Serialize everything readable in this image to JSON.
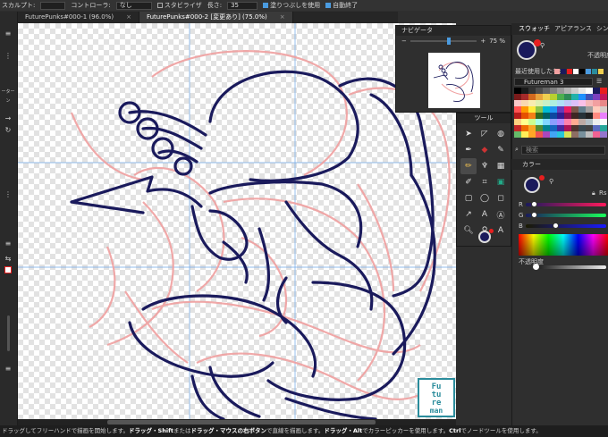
{
  "context_toolbar": {
    "sculpt_label": "スカルプト:",
    "sculpt_value": "",
    "controller_label": "コントローラ:",
    "controller_value": "なし",
    "stabilizer_label": "スタビライザ",
    "length_label": "長さ:",
    "length_value": "35",
    "fill_label": "塗りつぶしを使用",
    "autoclose_label": "自動終了"
  },
  "tabs": [
    {
      "label": "FuturePunks#000-1 (96.0%)",
      "close": "×"
    },
    {
      "label": "FuturePunks#000-2 [変更あり] (75.0%)",
      "close": "×"
    }
  ],
  "left_toolbar": {
    "snap_label": "ーターン"
  },
  "navigator": {
    "title": "ナビゲータ",
    "zoom": "75 %",
    "zoom_minus": "−",
    "zoom_plus": "+"
  },
  "tools_panel": {
    "title": "ツール"
  },
  "right_panel": {
    "tabs": [
      "スウォッチ",
      "アピアランス",
      "シンボル"
    ],
    "opacity_label": "不透明度",
    "recent_label": "最近使用したもの",
    "palette_name": "Futureman 3",
    "search_placeholder": "検索",
    "color_title": "カラー",
    "color_opacity_label": "不透明度",
    "channel_labels": [
      "R",
      "G",
      "B"
    ],
    "hex_prefix": "Rs"
  },
  "colors": {
    "accent": "#4a9be0",
    "fill_swatch": "#1a1a5c",
    "stroke_swatch": "#e81f1f",
    "sketch_line": "#f0a0a0",
    "ink_line": "#1a1a5c",
    "logo_teal": "#2a8c9c"
  },
  "palette_colors": [
    "#000000",
    "#1a1a1a",
    "#333333",
    "#4d4d4d",
    "#666666",
    "#808080",
    "#999999",
    "#b3b3b3",
    "#cccccc",
    "#e6e6e6",
    "#ffffff",
    "#1a1a5c",
    "#e81f1f",
    "#7a1a1a",
    "#a52a2a",
    "#d2691e",
    "#e8a33c",
    "#f0d050",
    "#b8d030",
    "#4caf50",
    "#2e8b57",
    "#20b2aa",
    "#1e90ff",
    "#3f51b5",
    "#7b3fbf",
    "#c2185b",
    "#f8c8c8",
    "#f8d8b0",
    "#f8ecb0",
    "#e0f0b0",
    "#c8f0c8",
    "#b0f0e0",
    "#b0e0f8",
    "#c0c8f8",
    "#dcc0f8",
    "#f8c0e8",
    "#f4b8b8",
    "#f2a0a0",
    "#e88888",
    "#ff5252",
    "#ff9800",
    "#ffeb3b",
    "#8bc34a",
    "#00bcd4",
    "#2196f3",
    "#673ab7",
    "#e91e63",
    "#795548",
    "#607d8b",
    "#9e9e9e",
    "#ffccbc",
    "#d7ccc8",
    "#b71c1c",
    "#e65100",
    "#f57f17",
    "#33691e",
    "#006064",
    "#0d47a1",
    "#311b92",
    "#880e4f",
    "#3e2723",
    "#263238",
    "#212121",
    "#ff8a80",
    "#ea80fc",
    "#ffd180",
    "#ffff8d",
    "#ccff90",
    "#a7ffeb",
    "#80d8ff",
    "#8c9eff",
    "#b388ff",
    "#ff80ab",
    "#ffab91",
    "#bcaaa4",
    "#b0bec5",
    "#eeeeee",
    "#fafafa",
    "#c62828",
    "#ef6c00",
    "#f9a825",
    "#558b2f",
    "#00838f",
    "#1565c0",
    "#4527a0",
    "#ad1457",
    "#4e342e",
    "#37474f",
    "#424242",
    "#5c6bc0",
    "#26a69a",
    "#66bb6a",
    "#ffee58",
    "#ffa726",
    "#ef5350",
    "#ab47bc",
    "#42a5f5",
    "#26c6da",
    "#d4e157",
    "#8d6e63",
    "#78909c",
    "#bdbdbd",
    "#f06292",
    "#9575cd"
  ],
  "recent_colors": [
    "#f2a0a0",
    "#1a1a5c",
    "#e81f1f",
    "#ffffff",
    "#000000",
    "#4a9be0",
    "#2a8c9c",
    "#f0d050"
  ],
  "logo": {
    "line1": "Fu",
    "line2": "tu",
    "line3": "re",
    "line4": "man"
  },
  "status": {
    "part1": "ドラッグしてフリーハンドで描画を開始します。",
    "part2": "ドラッグ・Shift",
    "part3": "または",
    "part4": "ドラッグ・マウスの右ボタン",
    "part5": "で直線を描画します。",
    "part6": "ドラッグ・Alt",
    "part7": "でカラーピッカーを使用します。",
    "part8": "Ctrl",
    "part9": "でノードツールを使用します。"
  }
}
